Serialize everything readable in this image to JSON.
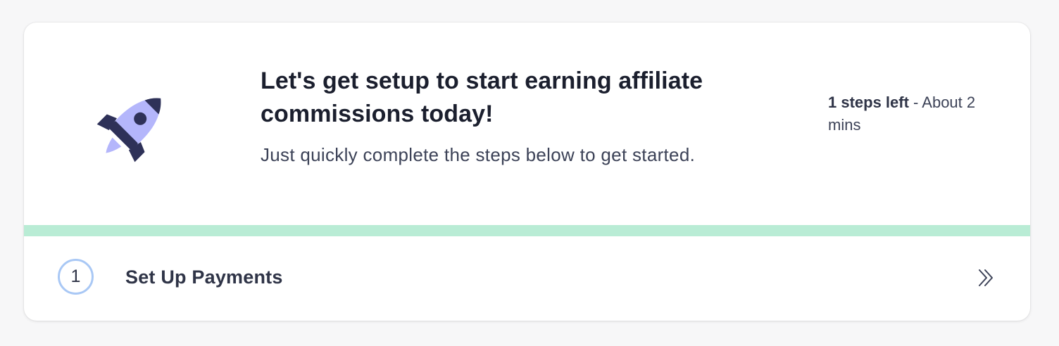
{
  "header": {
    "title": "Let's get setup to start earning affiliate commissions today!",
    "subtitle": "Just quickly complete the steps below to get started.",
    "steps_left": "1 steps left",
    "separator": " - ",
    "time_estimate": "About 2 mins"
  },
  "progress": {
    "fraction": 1.0,
    "color": "#b9ecd5"
  },
  "steps": [
    {
      "number": "1",
      "label": "Set Up Payments",
      "icon": "double-chevron-right-icon"
    }
  ],
  "illustration": {
    "icon": "rocket-icon",
    "colors": {
      "primary": "#2e3158",
      "accent": "#b4b6fb"
    }
  }
}
